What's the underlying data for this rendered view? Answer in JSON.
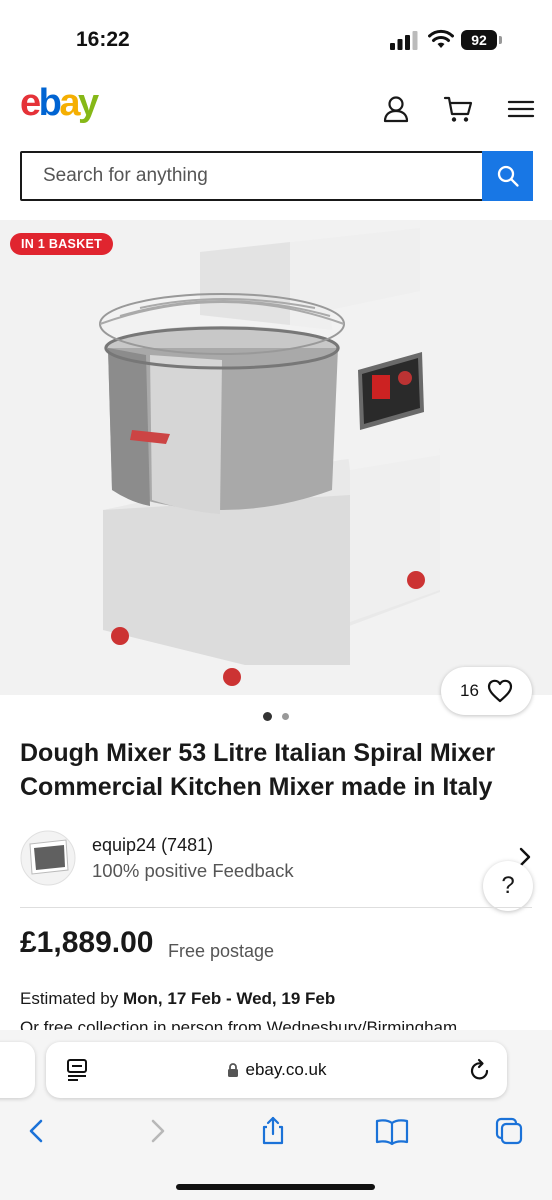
{
  "status": {
    "time": "16:22",
    "battery": "92"
  },
  "brand": {
    "letters": [
      "e",
      "b",
      "a",
      "y"
    ],
    "colors": [
      "#e53238",
      "#0064d2",
      "#f5af02",
      "#86b817"
    ]
  },
  "header": {
    "icons": [
      "account-icon",
      "basket-icon",
      "menu-icon"
    ]
  },
  "search": {
    "placeholder": "Search for anything"
  },
  "gallery": {
    "badge": "IN 1 BASKET",
    "watch_count": "16",
    "image_count": 2,
    "active_index": 0
  },
  "product": {
    "title": "Dough Mixer 53 Litre Italian Spiral Mixer Commercial Kitchen Mixer made in Italy"
  },
  "seller": {
    "name": "equip24 (7481)",
    "feedback": "100% positive Feedback"
  },
  "help": {
    "label": "?"
  },
  "pricing": {
    "price": "£1,889.00",
    "postage": "Free postage"
  },
  "delivery": {
    "prefix": "Estimated by",
    "dates": "Mon, 17 Feb - Wed, 19 Feb",
    "collection": "Or free collection in person from Wednesbury/Birmingham"
  },
  "browser": {
    "url": "ebay.co.uk"
  },
  "colors": {
    "accent": "#1877e5",
    "badge": "#e0252f",
    "safari_blue": "#1b72d8"
  }
}
